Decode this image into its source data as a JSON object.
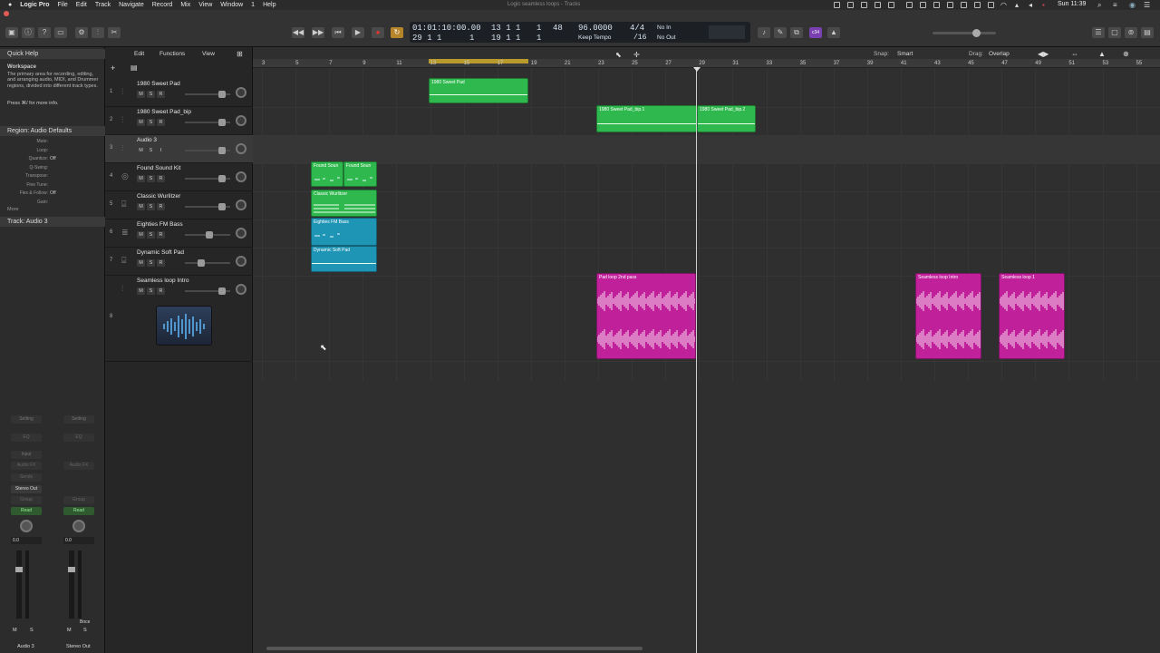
{
  "menubar": {
    "app_name": "Logic Pro",
    "items": [
      "File",
      "Edit",
      "Track",
      "Navigate",
      "Record",
      "Mix",
      "View",
      "Window",
      "1",
      "Help"
    ],
    "doc_title": "Logic seamless loops - Tracks",
    "clock": "Sun 11:39"
  },
  "lcd": {
    "time": "01:01:10:00.00",
    "bars_top": "13  1  1",
    "beat_top": "1",
    "bars_bottom": "29  1  1",
    "beat_bottom_a": "1",
    "bars_bottom2": "19  1  1",
    "beat_bottom_b": "1",
    "pos_a": "48",
    "tempo": "96.0000",
    "tempo_label": "Keep Tempo",
    "sig": "4/4",
    "div": "/16",
    "in": "No In",
    "out": "No Out"
  },
  "toolbar_badge": "c34",
  "area_menus": {
    "edit": "Edit",
    "functions": "Functions",
    "view": "View",
    "snap_label": "Snap:",
    "snap_value": "Smart",
    "drag_label": "Drag:",
    "drag_value": "Overlap"
  },
  "inspector": {
    "quick_help_title": "Quick Help",
    "workspace_title": "Workspace",
    "workspace_text": "The primary area for recording, editing, and arranging audio, MIDI, and Drummer regions, divided into different track types.",
    "press_hint": "Press ⌘/ for more info.",
    "region_header": "Region: Audio Defaults",
    "region_params": [
      {
        "label": "Mute:",
        "value": ""
      },
      {
        "label": "Loop:",
        "value": ""
      },
      {
        "label": "Quantize:",
        "value": "Off"
      },
      {
        "label": "Q-Swing:",
        "value": ""
      },
      {
        "label": "Transpose:",
        "value": ""
      },
      {
        "label": "Fine Tune:",
        "value": ""
      },
      {
        "label": "Flex & Follow:",
        "value": "Off"
      },
      {
        "label": "Gain:",
        "value": ""
      }
    ],
    "more_label": "More",
    "track_header": "Track: Audio 3",
    "strip_left": {
      "setting": "Setting",
      "eq": "EQ",
      "input": "Input",
      "audio_fx": "Audio FX",
      "sends": "Sends",
      "output": "Stereo Out",
      "group": "Group",
      "automation": "Read",
      "value": "0.0",
      "m": "M",
      "s": "S",
      "name": "Audio 3"
    },
    "strip_right": {
      "setting": "Setting",
      "eq": "EQ",
      "audio_fx": "Audio FX",
      "group": "Group",
      "automation": "Read",
      "value": "0.0",
      "m": "M",
      "s": "S",
      "bnce": "Bnce",
      "name": "Stereo Out"
    }
  },
  "tracks": [
    {
      "num": "1",
      "name": "1980 Sweet Pad",
      "m": "M",
      "s": "S",
      "r": "R",
      "fader": 0.8
    },
    {
      "num": "2",
      "name": "1980 Sweet Pad_bip",
      "m": "M",
      "s": "S",
      "r": "R",
      "fader": 0.8
    },
    {
      "num": "3",
      "name": "Audio 3",
      "m": "M",
      "s": "S",
      "r": "I",
      "fader": 0.8
    },
    {
      "num": "4",
      "name": "Found Sound Kit",
      "m": "M",
      "s": "S",
      "r": "R",
      "fader": 0.8
    },
    {
      "num": "5",
      "name": "Classic Wurlitzer",
      "m": "M",
      "s": "S",
      "r": "R",
      "fader": 0.8
    },
    {
      "num": "6",
      "name": "Eighties FM Bass",
      "m": "M",
      "s": "S",
      "r": "R",
      "fader": 0.5
    },
    {
      "num": "7",
      "name": "Dynamic Soft Pad",
      "m": "M",
      "s": "S",
      "r": "R",
      "fader": 0.3
    },
    {
      "num": "8",
      "name": "Seamless loop Intro",
      "m": "M",
      "s": "S",
      "r": "R",
      "fader": 0.8
    }
  ],
  "ruler": [
    "3",
    "5",
    "7",
    "9",
    "11",
    "13",
    "15",
    "17",
    "19",
    "21",
    "23",
    "25",
    "27",
    "29",
    "31",
    "33",
    "35",
    "37",
    "39",
    "41",
    "43",
    "45",
    "47",
    "49",
    "51",
    "53",
    "55"
  ],
  "regions": [
    {
      "label": "1980 Sweet Pad",
      "color": "#2fb84d"
    },
    {
      "label": "1980 Sweet Pad_bip.1",
      "color": "#2fb84d"
    },
    {
      "label": "1980 Sweet Pad_bip.2",
      "color": "#2fb84d"
    },
    {
      "label": "Found Soun",
      "color": "#2fb84d"
    },
    {
      "label": "Found Soun",
      "color": "#2fb84d"
    },
    {
      "label": "Classic Wurlitzer",
      "color": "#2fb84d"
    },
    {
      "label": "Eighties FM Bass",
      "color": "#1f95b5"
    },
    {
      "label": "Dynamic Soft Pad",
      "color": "#1f95b5"
    },
    {
      "label": "Pad loop 2nd pass",
      "color": "#c0219b"
    },
    {
      "label": "Seamless loop Intro",
      "color": "#c0219b"
    },
    {
      "label": "Seamless loop 1",
      "color": "#c0219b"
    }
  ],
  "colors": {
    "accent": "#b99a2c",
    "record": "#d33",
    "cycle": "#d6a72a"
  }
}
